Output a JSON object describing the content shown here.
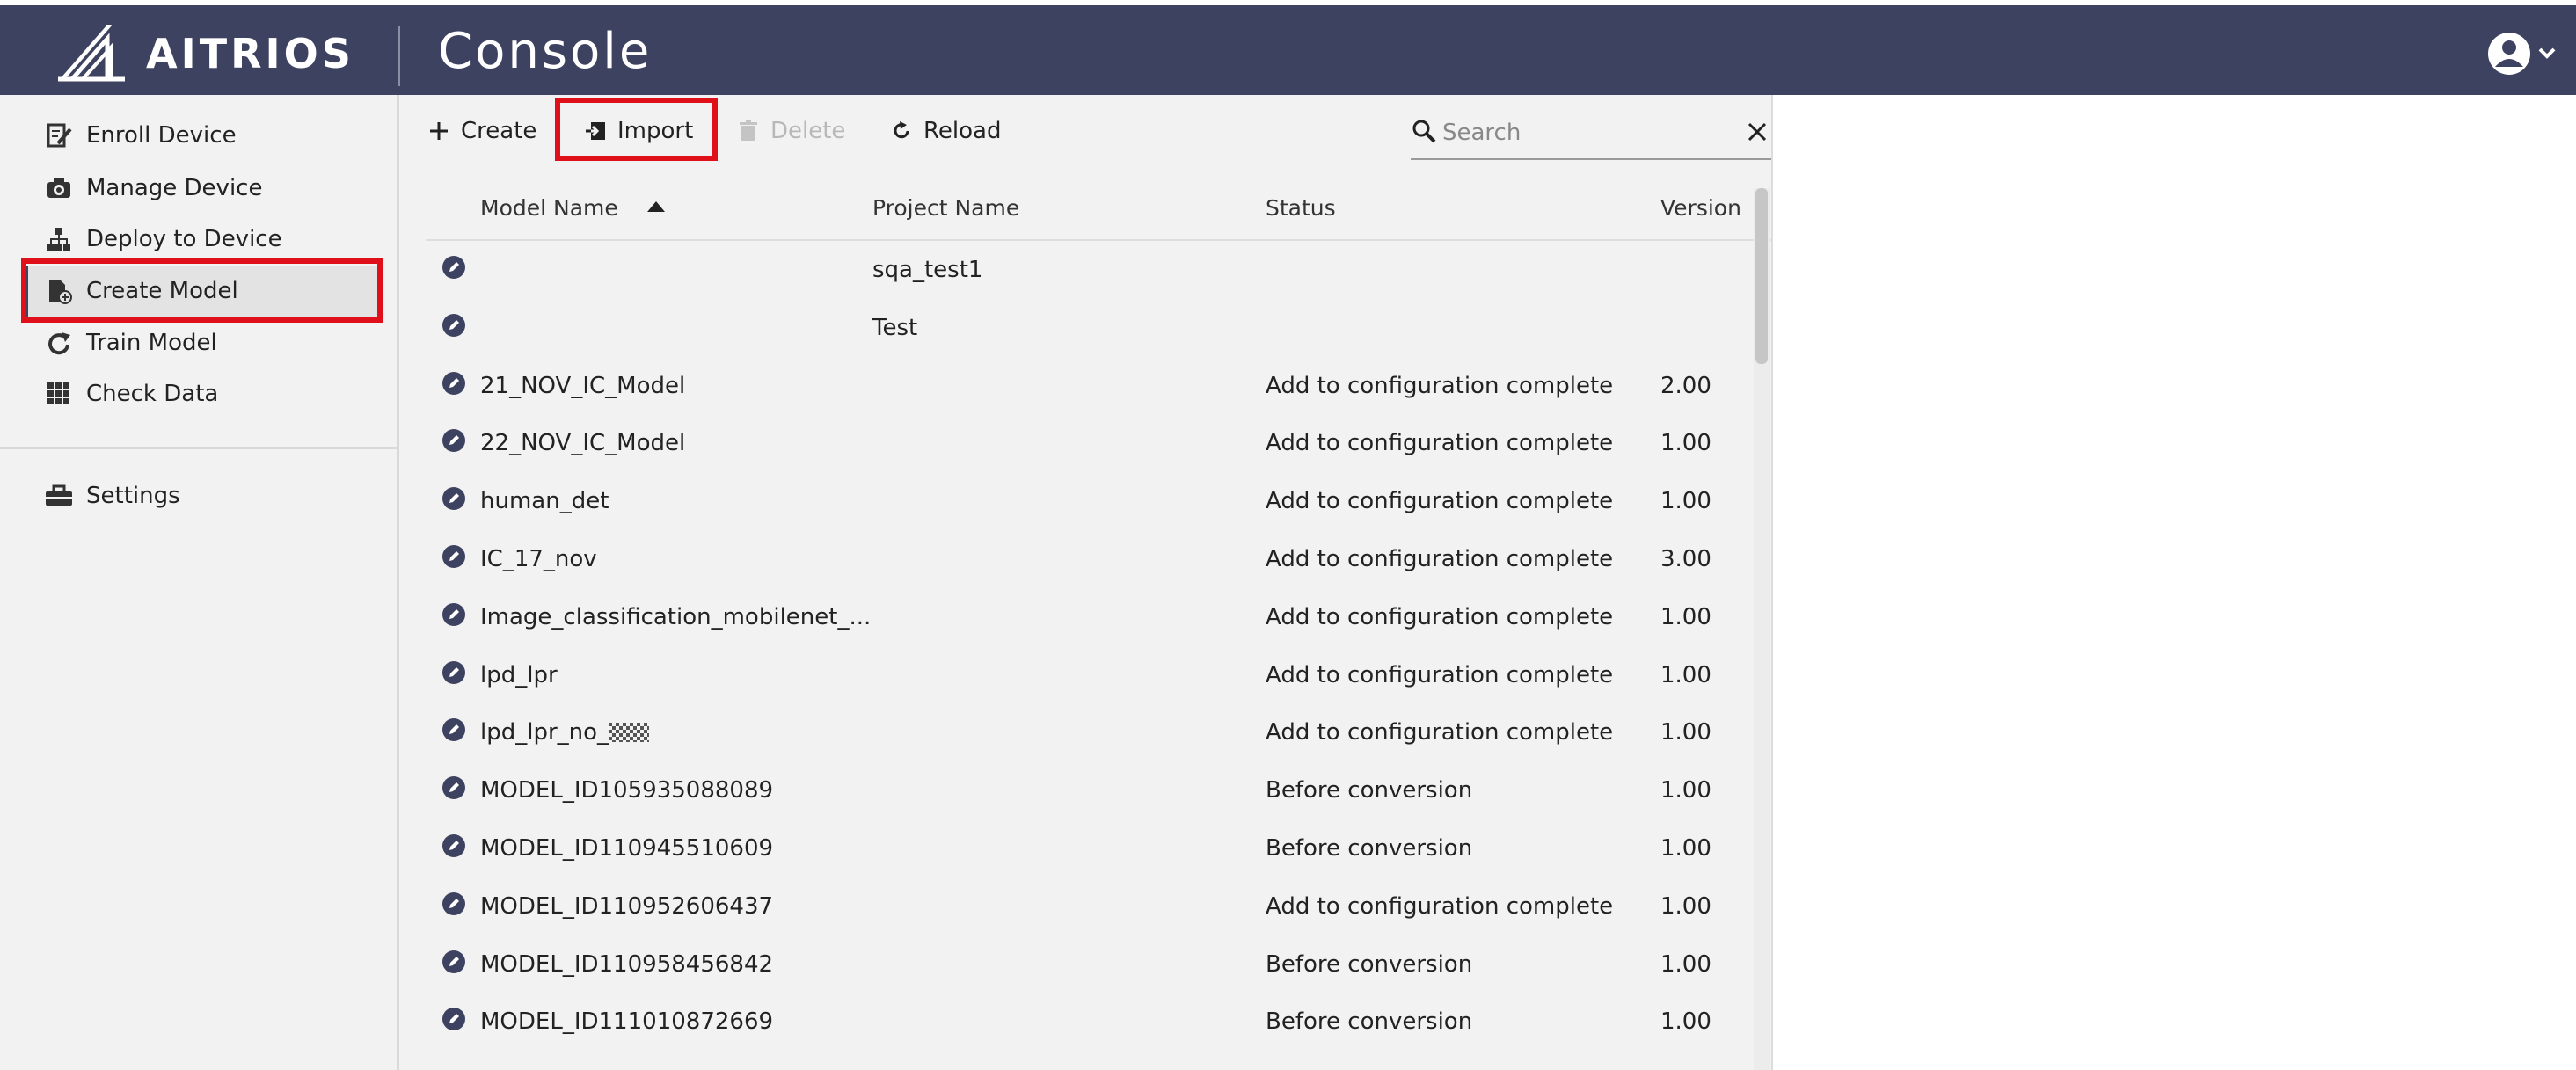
{
  "header": {
    "brand": "AITRIOS",
    "title": "Console"
  },
  "sidebar": {
    "items": [
      {
        "label": "Enroll Device",
        "icon": "enroll-icon"
      },
      {
        "label": "Manage Device",
        "icon": "camera-icon"
      },
      {
        "label": "Deploy to Device",
        "icon": "hierarchy-icon"
      },
      {
        "label": "Create Model",
        "icon": "create-model-icon",
        "active": true
      },
      {
        "label": "Train Model",
        "icon": "refresh-icon"
      },
      {
        "label": "Check Data",
        "icon": "grid-icon"
      }
    ],
    "settings": {
      "label": "Settings",
      "icon": "toolbox-icon"
    }
  },
  "toolbar": {
    "create_label": "Create",
    "import_label": "Import",
    "delete_label": "Delete",
    "reload_label": "Reload",
    "search_placeholder": "Search"
  },
  "table": {
    "columns": [
      "Model Name",
      "Project Name",
      "Status",
      "Version"
    ],
    "sort_column": "Model Name",
    "sort_direction": "ascending",
    "rows": [
      {
        "model": "",
        "project": "sqa_test1",
        "status": "",
        "version": ""
      },
      {
        "model": "",
        "project": "Test",
        "status": "",
        "version": ""
      },
      {
        "model": "21_NOV_IC_Model",
        "project": "",
        "status": "Add to configuration complete",
        "version": "2.00"
      },
      {
        "model": "22_NOV_IC_Model",
        "project": "",
        "status": "Add to configuration complete",
        "version": "1.00"
      },
      {
        "model": "human_det",
        "project": "",
        "status": "Add to configuration complete",
        "version": "1.00"
      },
      {
        "model": "IC_17_nov",
        "project": "",
        "status": "Add to configuration complete",
        "version": "3.00"
      },
      {
        "model": "Image_classification_mobilenet_...",
        "project": "",
        "status": "Add to configuration complete",
        "version": "1.00"
      },
      {
        "model": "lpd_lpr",
        "project": "",
        "status": "Add to configuration complete",
        "version": "1.00"
      },
      {
        "model": "lpd_lpr_no_",
        "project": "",
        "status": "Add to configuration complete",
        "version": "1.00"
      },
      {
        "model": "MODEL_ID105935088089",
        "project": "",
        "status": "Before conversion",
        "version": "1.00"
      },
      {
        "model": "MODEL_ID110945510609",
        "project": "",
        "status": "Before conversion",
        "version": "1.00"
      },
      {
        "model": "MODEL_ID110952606437",
        "project": "",
        "status": "Add to configuration complete",
        "version": "1.00"
      },
      {
        "model": "MODEL_ID110958456842",
        "project": "",
        "status": "Before conversion",
        "version": "1.00"
      },
      {
        "model": "MODEL_ID111010872669",
        "project": "",
        "status": "Before conversion",
        "version": "1.00"
      }
    ]
  },
  "colors": {
    "header_bg": "#3d4260",
    "highlight": "#e0101a",
    "panel_bg": "#f2f2f2"
  }
}
